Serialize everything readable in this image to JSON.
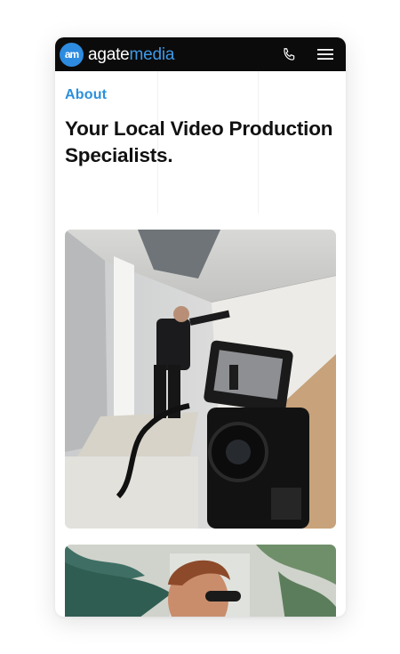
{
  "header": {
    "logo_mark": "am",
    "logo_word_primary": "agate",
    "logo_word_secondary": "media",
    "icons": [
      "phone-icon",
      "hamburger-menu-icon"
    ]
  },
  "about": {
    "eyebrow": "About",
    "heading": "Your Local Video Production Specialists."
  },
  "images": [
    "photo-camera-filming-painter",
    "photo-man-with-sunglasses-plants"
  ],
  "colors": {
    "brand_blue": "#2d8be0",
    "navbar_bg": "#0b0b0b",
    "heading_text": "#111111"
  }
}
